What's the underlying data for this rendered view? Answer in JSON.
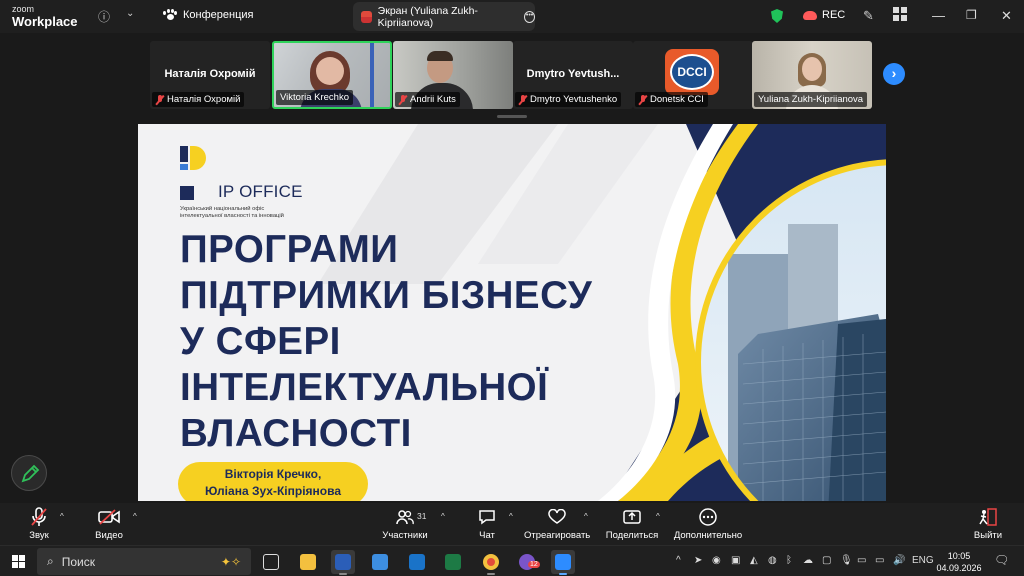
{
  "app": {
    "brand_top": "zoom",
    "brand_bottom": "Workplace",
    "meeting_label": "Конференция",
    "screen_tab_label": "Экран (Yuliana Zukh-Kipriianova)",
    "rec_label": "REC"
  },
  "participants": [
    {
      "big_name": "Наталія Охромій",
      "label": "Наталія Охромій",
      "muted": true
    },
    {
      "big_name": "",
      "label": "Viktoria Krechko",
      "muted": false
    },
    {
      "big_name": "",
      "label": "Andrii Kuts",
      "muted": true
    },
    {
      "big_name": "Dmytro  Yevtush...",
      "label": "Dmytro Yevtushenko",
      "muted": true
    },
    {
      "big_name": "",
      "label": "Donetsk CCI",
      "muted": true,
      "logo_text": "DCCI"
    },
    {
      "big_name": "",
      "label": "Yuliana Zukh-Kipriianova",
      "muted": false
    }
  ],
  "slide": {
    "logo_text": "IP OFFICE",
    "logo_sub_line1": "Український національний офіс",
    "logo_sub_line2": "інтелектуальної власності та інновацій",
    "headline": [
      "ПРОГРАМИ",
      "ПІДТРИМКИ БІЗНЕСУ",
      "У СФЕРІ",
      "ІНТЕЛЕКТУАЛЬНОЇ",
      "ВЛАСНОСТІ"
    ],
    "authors_line1": "Вікторія Кречко,",
    "authors_line2": "Юліана Зух-Кіпріянова"
  },
  "controls": {
    "audio": "Звук",
    "video": "Видео",
    "participants": "Участники",
    "participants_count": "31",
    "chat": "Чат",
    "react": "Отреагировать",
    "share": "Поделиться",
    "more": "Дополнительно",
    "leave": "Выйти"
  },
  "taskbar": {
    "search_placeholder": "Поиск",
    "language": "ENG",
    "time": "10:05",
    "date": "04.09.2026",
    "viber_badge": "12"
  },
  "colors": {
    "slide_navy": "#1d2b5a",
    "slide_yellow": "#f6d021",
    "active_speaker": "#2fd35a",
    "zoom_blue": "#2d8cff",
    "muted_red": "#e84545"
  }
}
